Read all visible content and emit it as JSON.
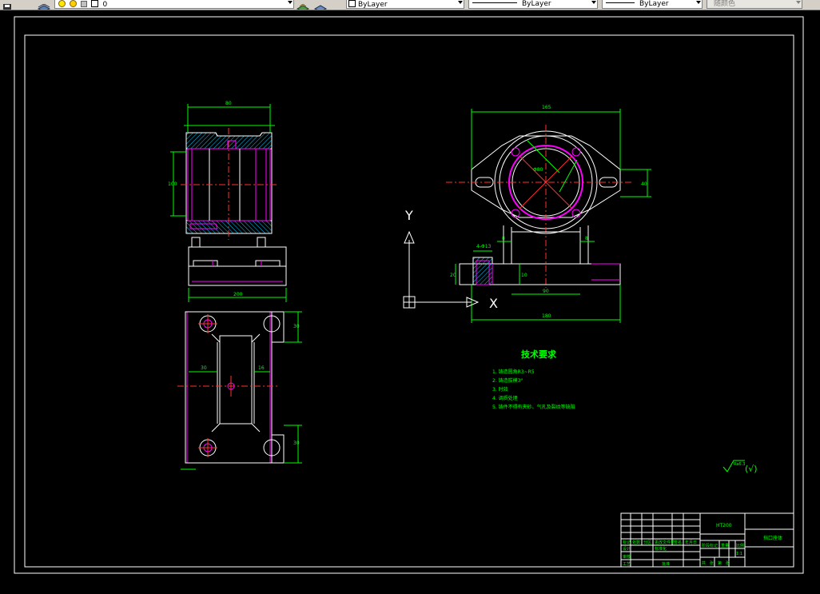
{
  "toolbar": {
    "layer_name": "0",
    "color_value": "ByLayer",
    "linetype_value": "ByLayer",
    "lineweight_value": "ByLayer",
    "plotstyle_value": "随颜色"
  },
  "drawing": {
    "tech_title": "技术要求",
    "tech_notes": [
      "1. 铸造圆角R3~R5",
      "2. 铸造拔模3°",
      "3. 时效",
      "4. 调质处理",
      "5. 铸件不得有夹砂、气孔及裂纹等缺陷"
    ],
    "axis_y": "Y",
    "axis_x": "X",
    "roughness_value": "Ra6.3",
    "roughness_paren": "(√)",
    "title_block": {
      "part_name": "挡口座体",
      "material": "HT200",
      "scale": "1:1",
      "cell_labels": [
        "标记",
        "处数",
        "分区",
        "更改文件号",
        "签名",
        "年月日",
        "设计",
        "标准化",
        "审核",
        "工艺",
        "批准",
        "阶段标记",
        "重量",
        "比例",
        "共",
        "张",
        "第",
        "张"
      ]
    },
    "dimensions": {
      "left_top_width": "80",
      "left_height": "100",
      "left_base_width": "200",
      "bottom_right_upper": "30",
      "bottom_right_lower": "30",
      "bottom_left_offset": "30",
      "bottom_mid_offset": "16",
      "right_top_width": "165",
      "right_bore": "Φ80",
      "right_ear_height": "40",
      "right_base_width": "180",
      "right_center_height": "90",
      "right_small_width": "4-Φ13",
      "right_left_height": "20",
      "right_dim_8a": "8",
      "right_dim_8b": "8",
      "right_dim_10": "10"
    }
  }
}
